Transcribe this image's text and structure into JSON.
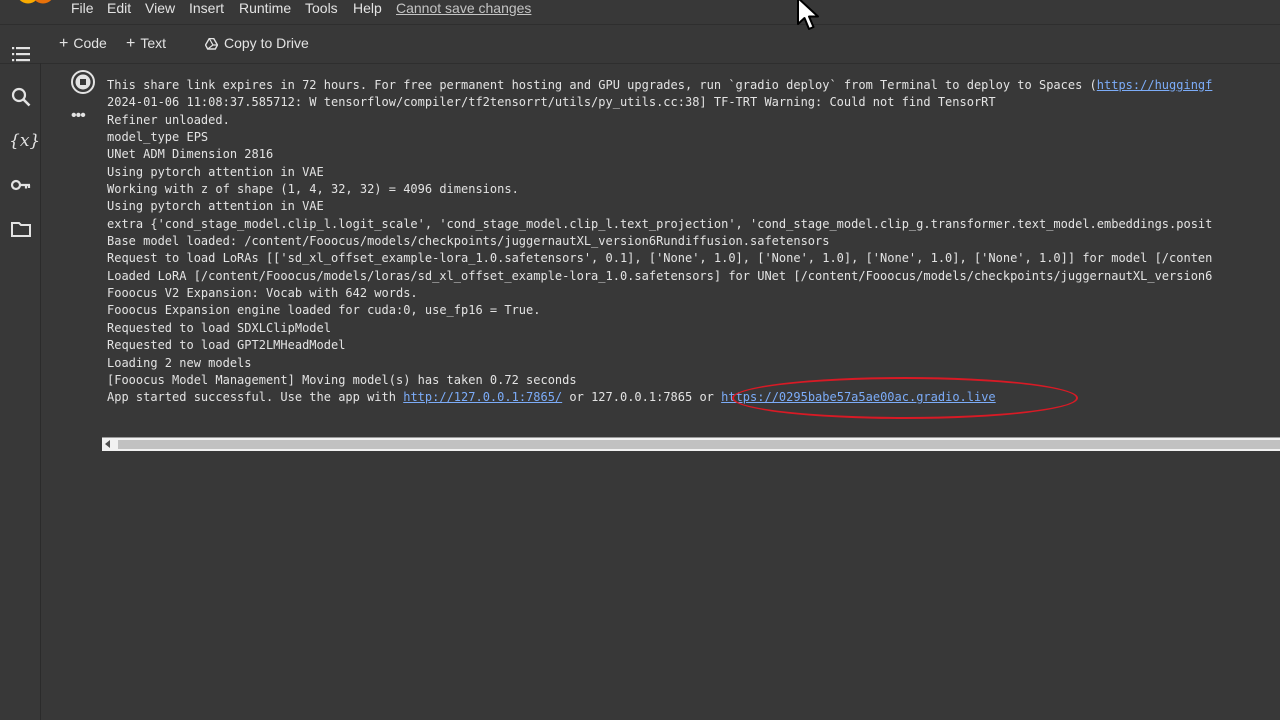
{
  "menu": {
    "items": [
      "File",
      "Edit",
      "View",
      "Insert",
      "Runtime",
      "Tools",
      "Help"
    ],
    "warning": "Cannot save changes"
  },
  "toolbar": {
    "code_label": "Code",
    "text_label": "Text",
    "copy_label": "Copy to Drive"
  },
  "sidebar": {
    "icons": [
      "table-of-contents-icon",
      "search-icon",
      "variables-icon",
      "key-icon",
      "folder-icon"
    ],
    "variables_glyph": "{x}"
  },
  "cell": {
    "more_glyph": "•••"
  },
  "output": {
    "lines": [
      {
        "text": "This share link expires in 72 hours. For free permanent hosting and GPU upgrades, run `gradio deploy` from Terminal to deploy to Spaces (",
        "link": "https://huggingf"
      },
      {
        "text": "2024-01-06 11:08:37.585712: W tensorflow/compiler/tf2tensorrt/utils/py_utils.cc:38] TF-TRT Warning: Could not find TensorRT"
      },
      {
        "text": "Refiner unloaded."
      },
      {
        "text": "model_type EPS"
      },
      {
        "text": "UNet ADM Dimension 2816"
      },
      {
        "text": "Using pytorch attention in VAE"
      },
      {
        "text": "Working with z of shape (1, 4, 32, 32) = 4096 dimensions."
      },
      {
        "text": "Using pytorch attention in VAE"
      },
      {
        "text": "extra {'cond_stage_model.clip_l.logit_scale', 'cond_stage_model.clip_l.text_projection', 'cond_stage_model.clip_g.transformer.text_model.embeddings.posit"
      },
      {
        "text": "Base model loaded: /content/Fooocus/models/checkpoints/juggernautXL_version6Rundiffusion.safetensors"
      },
      {
        "text": "Request to load LoRAs [['sd_xl_offset_example-lora_1.0.safetensors', 0.1], ['None', 1.0], ['None', 1.0], ['None', 1.0], ['None', 1.0]] for model [/conten"
      },
      {
        "text": "Loaded LoRA [/content/Fooocus/models/loras/sd_xl_offset_example-lora_1.0.safetensors] for UNet [/content/Fooocus/models/checkpoints/juggernautXL_version6"
      },
      {
        "text": "Fooocus V2 Expansion: Vocab with 642 words."
      },
      {
        "text": "Fooocus Expansion engine loaded for cuda:0, use_fp16 = True."
      },
      {
        "text": "Requested to load SDXLClipModel"
      },
      {
        "text": "Requested to load GPT2LMHeadModel"
      },
      {
        "text": "Loading 2 new models"
      },
      {
        "text": "[Fooocus Model Management] Moving model(s) has taken 0.72 seconds"
      }
    ],
    "last_line": {
      "prefix": "App started successful. Use the app with ",
      "local_link": "http://127.0.0.1:7865/",
      "middle": " or 127.0.0.1:7865 or ",
      "public_link": "https://0295babe57a5ae00ac.gradio.live"
    }
  },
  "colors": {
    "background": "#383838",
    "link": "#7cacf8",
    "highlight_ellipse": "#d81a25"
  }
}
